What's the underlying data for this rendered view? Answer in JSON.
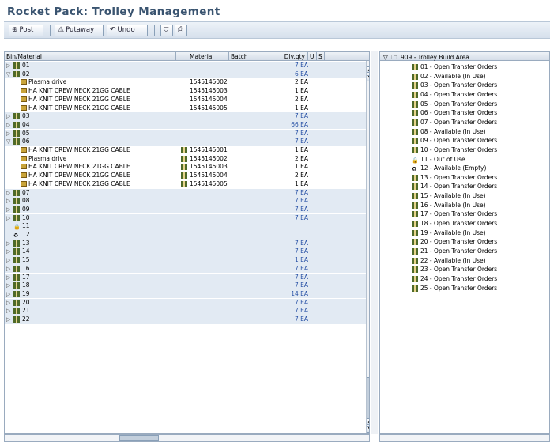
{
  "window": {
    "title": "Rocket Pack: Trolley Management"
  },
  "toolbar": {
    "post": "Post",
    "putaway": "Putaway",
    "undo": "Undo"
  },
  "table": {
    "columns": [
      "Bin/Material",
      "Material",
      "Batch",
      "Dlv.qty",
      "U",
      "S"
    ],
    "rows": [
      {
        "type": "bin",
        "bin": "01",
        "qty": "7 EA",
        "expanded": false
      },
      {
        "type": "bin",
        "bin": "02",
        "qty": "6 EA",
        "expanded": true
      },
      {
        "type": "mat",
        "desc": "Plasma drive",
        "material": "1545145002",
        "qty": "2 EA"
      },
      {
        "type": "mat",
        "desc": "HA KNIT CREW NECK 21GG CABLE",
        "material": "1545145003",
        "qty": "1 EA"
      },
      {
        "type": "mat",
        "desc": "HA KNIT CREW NECK 21GG CABLE",
        "material": "1545145004",
        "qty": "2 EA"
      },
      {
        "type": "mat",
        "desc": "HA KNIT CREW NECK 21GG CABLE",
        "material": "1545145005",
        "qty": "1 EA"
      },
      {
        "type": "bin",
        "bin": "03",
        "qty": "7 EA",
        "expanded": false
      },
      {
        "type": "bin",
        "bin": "04",
        "qty": "66 EA",
        "expanded": false
      },
      {
        "type": "bin",
        "bin": "05",
        "qty": "7 EA",
        "expanded": false
      },
      {
        "type": "bin",
        "bin": "06",
        "qty": "7 EA",
        "expanded": true
      },
      {
        "type": "mat",
        "desc": "HA KNIT CREW NECK 21GG CABLE",
        "material": "1545145001",
        "qty": "1 EA",
        "bin_icon": true
      },
      {
        "type": "mat",
        "desc": "Plasma drive",
        "material": "1545145002",
        "qty": "2 EA",
        "bin_icon": true
      },
      {
        "type": "mat",
        "desc": "HA KNIT CREW NECK 21GG CABLE",
        "material": "1545145003",
        "qty": "1 EA",
        "bin_icon": true
      },
      {
        "type": "mat",
        "desc": "HA KNIT CREW NECK 21GG CABLE",
        "material": "1545145004",
        "qty": "2 EA",
        "bin_icon": true
      },
      {
        "type": "mat",
        "desc": "HA KNIT CREW NECK 21GG CABLE",
        "material": "1545145005",
        "qty": "1 EA",
        "bin_icon": true
      },
      {
        "type": "bin",
        "bin": "07",
        "qty": "7 EA",
        "expanded": false
      },
      {
        "type": "bin",
        "bin": "08",
        "qty": "7 EA",
        "expanded": false
      },
      {
        "type": "bin",
        "bin": "09",
        "qty": "7 EA",
        "expanded": false
      },
      {
        "type": "bin",
        "bin": "10",
        "qty": "7 EA",
        "expanded": false
      },
      {
        "type": "bin",
        "bin": "11",
        "qty": "",
        "expanded": null,
        "icon": "lock-icon"
      },
      {
        "type": "bin",
        "bin": "12",
        "qty": "",
        "expanded": null,
        "icon": "empty-trolley-icon"
      },
      {
        "type": "bin",
        "bin": "13",
        "qty": "7 EA",
        "expanded": false
      },
      {
        "type": "bin",
        "bin": "14",
        "qty": "7 EA",
        "expanded": false
      },
      {
        "type": "bin",
        "bin": "15",
        "qty": "1 EA",
        "expanded": false
      },
      {
        "type": "bin",
        "bin": "16",
        "qty": "7 EA",
        "expanded": false
      },
      {
        "type": "bin",
        "bin": "17",
        "qty": "7 EA",
        "expanded": false
      },
      {
        "type": "bin",
        "bin": "18",
        "qty": "7 EA",
        "expanded": false
      },
      {
        "type": "bin",
        "bin": "19",
        "qty": "14 EA",
        "expanded": false
      },
      {
        "type": "bin",
        "bin": "20",
        "qty": "7 EA",
        "expanded": false
      },
      {
        "type": "bin",
        "bin": "21",
        "qty": "7 EA",
        "expanded": false
      },
      {
        "type": "bin",
        "bin": "22",
        "qty": "7 EA",
        "expanded": false
      }
    ]
  },
  "tree": {
    "root": "909 - Trolley Build Area",
    "items": [
      "01 - Open Transfer Orders",
      "02 - Available (In Use)",
      "03 - Open Transfer Orders",
      "04 - Open Transfer Orders",
      "05 - Open Transfer Orders",
      "06 - Open Transfer Orders",
      "07 - Open Transfer Orders",
      "08 - Available (In Use)",
      "09 - Open Transfer Orders",
      "10 - Open Transfer Orders",
      "11 - Out of Use",
      "12 - Available (Empty)",
      "13 - Open Transfer Orders",
      "14 - Open Transfer Orders",
      "15 - Available (In Use)",
      "16 - Available (In Use)",
      "17 - Open Transfer Orders",
      "18 - Open Transfer Orders",
      "19 - Available (In Use)",
      "20 - Open Transfer Orders",
      "21 - Open Transfer Orders",
      "22 - Available (In Use)",
      "23 - Open Transfer Orders",
      "24 - Open Transfer Orders",
      "25 - Open Transfer Orders"
    ]
  },
  "colors": {
    "shade": "#e2eaf3",
    "qty": "#2a53a6",
    "title": "#3a5470"
  }
}
